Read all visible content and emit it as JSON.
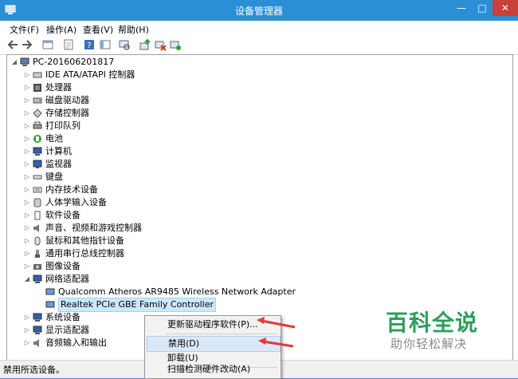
{
  "window": {
    "title": "设备管理器",
    "min_label": "—",
    "max_label": "□",
    "close_label": "✕"
  },
  "menu": [
    "文件(F)",
    "操作(A)",
    "查看(V)",
    "帮助(H)"
  ],
  "toolbar": [
    "back-icon",
    "forward-icon",
    "view-icon",
    "props-icon",
    "help-icon",
    "console-icon",
    "scan-icon",
    "update-driver-icon",
    "disable-icon",
    "uninstall-icon"
  ],
  "tree": {
    "root": "PC-201606201817",
    "items": [
      "IDE ATA/ATAPI 控制器",
      "处理器",
      "磁盘驱动器",
      "存储控制器",
      "打印队列",
      "电池",
      "计算机",
      "监视器",
      "键盘",
      "内存技术设备",
      "人体学输入设备",
      "软件设备",
      "声音、视频和游戏控制器",
      "鼠标和其他指针设备",
      "通用串行总线控制器",
      "图像设备",
      "网络适配器"
    ],
    "network_children": [
      "Qualcomm Atheros AR9485 Wireless Network Adapter",
      "Realtek PCIe GBE Family Controller"
    ],
    "after": [
      "系统设备",
      "显示适配器",
      "音频输入和输出"
    ]
  },
  "context_menu": {
    "update": "更新驱动程序软件(P)...",
    "disable": "禁用(D)",
    "uninstall": "卸载(U)",
    "scan": "扫描检测硬件改动(A)"
  },
  "status": "禁用所选设备。",
  "watermark": {
    "title": "百科全说",
    "subtitle": "助你轻松解决"
  },
  "colors": {
    "titlebar": "#2b8fd6",
    "close": "#c7403a",
    "arrow": "#e03a3a",
    "watermark": "#2e9e5c"
  }
}
